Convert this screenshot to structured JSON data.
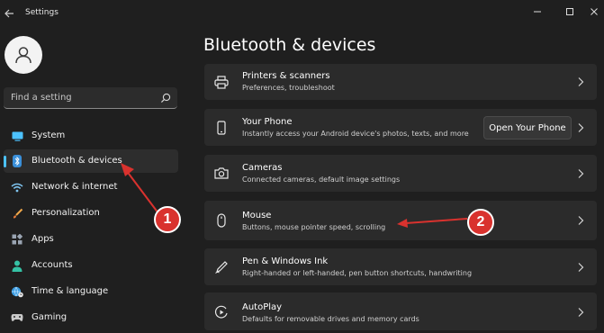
{
  "window": {
    "app_title": "Settings",
    "back_icon": "back-arrow-icon",
    "minimize_icon": "minimize-icon",
    "maximize_icon": "maximize-icon",
    "close_icon": "close-icon"
  },
  "search": {
    "placeholder": "Find a setting",
    "icon": "search-icon"
  },
  "sidebar": {
    "items": [
      {
        "label": "System",
        "icon": "monitor-icon",
        "selected": false
      },
      {
        "label": "Bluetooth & devices",
        "icon": "bluetooth-icon",
        "selected": true
      },
      {
        "label": "Network & internet",
        "icon": "wifi-icon",
        "selected": false
      },
      {
        "label": "Personalization",
        "icon": "brush-icon",
        "selected": false
      },
      {
        "label": "Apps",
        "icon": "apps-icon",
        "selected": false
      },
      {
        "label": "Accounts",
        "icon": "person-icon",
        "selected": false
      },
      {
        "label": "Time & language",
        "icon": "globe-clock-icon",
        "selected": false
      },
      {
        "label": "Gaming",
        "icon": "controller-icon",
        "selected": false
      }
    ]
  },
  "main": {
    "title": "Bluetooth & devices",
    "cards": [
      {
        "title": "Printers & scanners",
        "subtitle": "Preferences, troubleshoot",
        "icon": "printer-icon"
      },
      {
        "title": "Your Phone",
        "subtitle": "Instantly access your Android device's photos, texts, and more",
        "icon": "phone-icon",
        "button_label": "Open Your Phone"
      },
      {
        "title": "Cameras",
        "subtitle": "Connected cameras, default image settings",
        "icon": "camera-icon"
      },
      {
        "title": "Mouse",
        "subtitle": "Buttons, mouse pointer speed, scrolling",
        "icon": "mouse-icon"
      },
      {
        "title": "Pen & Windows Ink",
        "subtitle": "Right-handed or left-handed, pen button shortcuts, handwriting",
        "icon": "pen-icon"
      },
      {
        "title": "AutoPlay",
        "subtitle": "Defaults for removable drives and memory cards",
        "icon": "autoplay-icon"
      }
    ]
  },
  "annotations": {
    "badge_1": "1",
    "badge_2": "2",
    "color": "#d9322e"
  },
  "colors": {
    "accent": "#4cc2ff",
    "background": "#1f1f1f",
    "card": "#2b2b2b"
  }
}
